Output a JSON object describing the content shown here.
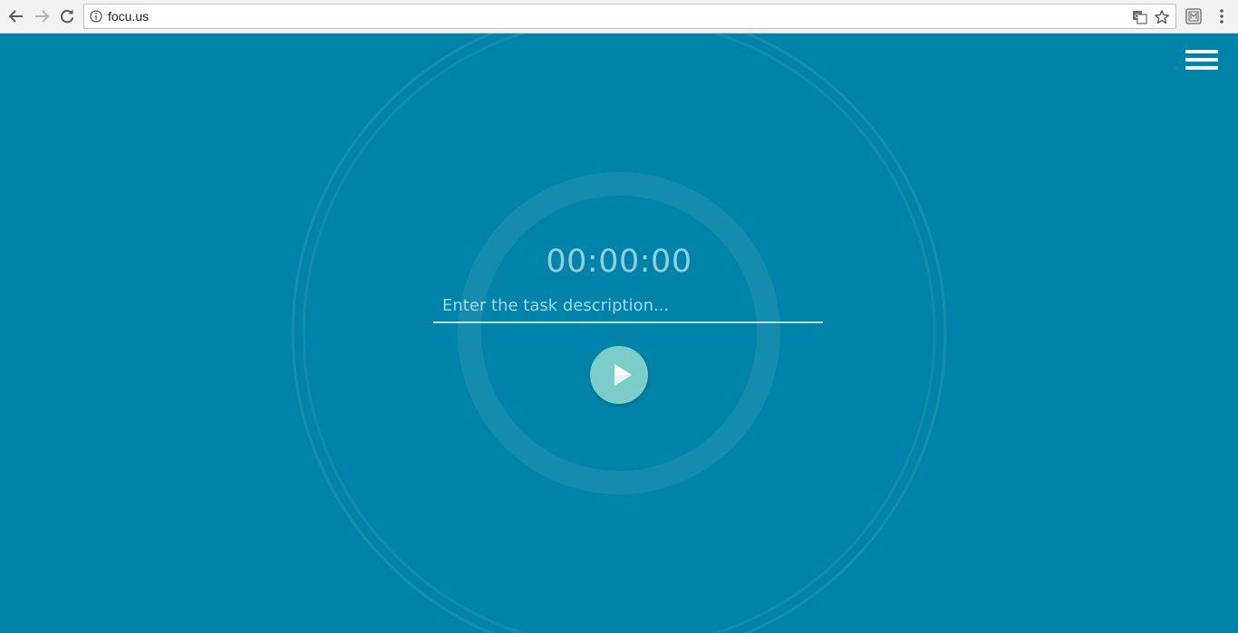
{
  "browser": {
    "url": "focu.us",
    "icons": [
      "back-arrow-icon",
      "forward-arrow-icon",
      "reload-icon",
      "info-icon",
      "translate-icon",
      "star-icon",
      "extension-icon",
      "more-vertical-icon"
    ]
  },
  "app": {
    "timer": "00:00:00",
    "task_placeholder": "Enter the task description...",
    "menu_icon": "hamburger-menu-icon",
    "play_icon": "play-icon",
    "colors": {
      "background": "#0083a8",
      "play_button": "#7ccdca",
      "timer_text": "#8fd0e0"
    }
  }
}
